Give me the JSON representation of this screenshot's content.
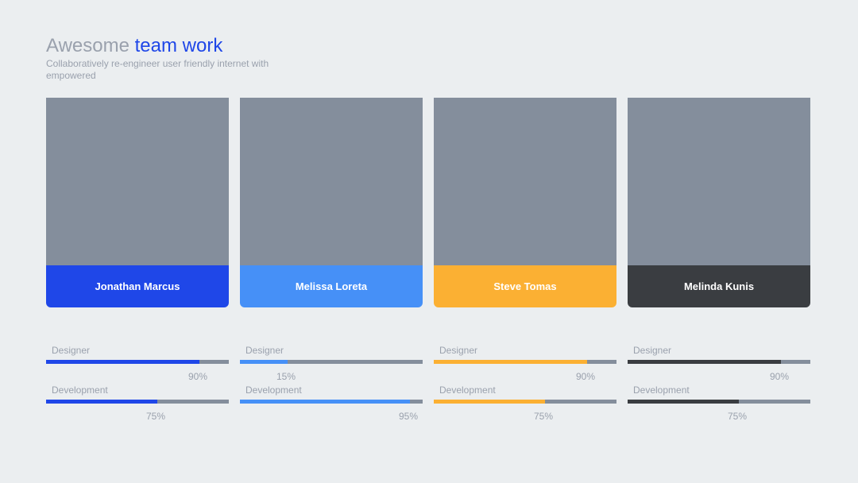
{
  "header": {
    "title_part1": "Awesome",
    "title_part2": "team work",
    "subtitle": "Collaboratively re-engineer user friendly internet with empowered"
  },
  "members": [
    {
      "name": "Jonathan Marcus",
      "color": "#1f47e8",
      "skills": [
        {
          "label": "Designer",
          "value": 84,
          "display": "90%"
        },
        {
          "label": "Development",
          "value": 61,
          "display": "75%"
        }
      ]
    },
    {
      "name": "Melissa Loreta",
      "color": "#4690f7",
      "skills": [
        {
          "label": "Designer",
          "value": 26,
          "display": "15%"
        },
        {
          "label": "Development",
          "value": 93,
          "display": "95%"
        }
      ]
    },
    {
      "name": "Steve Tomas",
      "color": "#fbb033",
      "skills": [
        {
          "label": "Designer",
          "value": 84,
          "display": "90%"
        },
        {
          "label": "Development",
          "value": 61,
          "display": "75%"
        }
      ]
    },
    {
      "name": "Melinda Kunis",
      "color": "#3a3d41",
      "skills": [
        {
          "label": "Designer",
          "value": 84,
          "display": "90%"
        },
        {
          "label": "Development",
          "value": 61,
          "display": "75%"
        }
      ]
    }
  ]
}
